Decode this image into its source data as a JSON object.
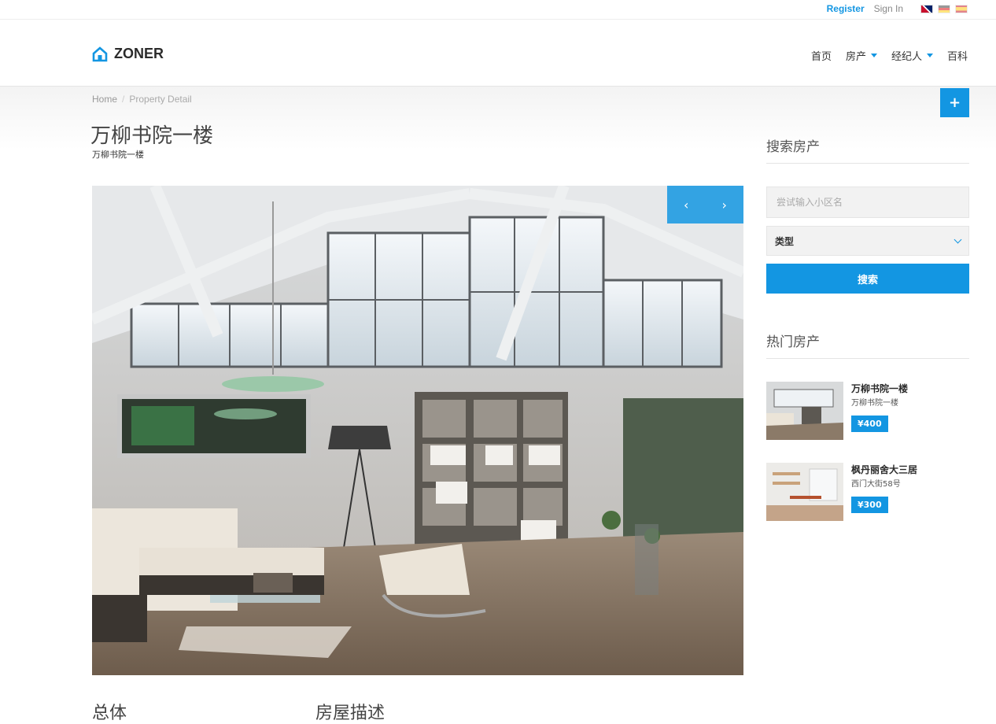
{
  "topbar": {
    "register": "Register",
    "signin": "Sign In"
  },
  "brand": {
    "name": "ZONER"
  },
  "nav": {
    "home": "首页",
    "property": "房产",
    "agents": "经纪人",
    "wiki": "百科"
  },
  "breadcrumb": {
    "home": "Home",
    "sep": "/",
    "current": "Property Detail"
  },
  "property": {
    "title": "万柳书院一楼",
    "subtitle": "万柳书院一楼"
  },
  "add_button": "+",
  "slider": {
    "prev": "‹",
    "next": "›"
  },
  "sections": {
    "overview": "总体",
    "description": "房屋描述"
  },
  "search": {
    "title": "搜索房产",
    "placeholder": "尝试输入小区名",
    "type_label": "类型",
    "button": "搜索"
  },
  "hot": {
    "title": "热门房产",
    "items": [
      {
        "name": "万柳书院一楼",
        "address": "万柳书院一楼",
        "price": "¥400"
      },
      {
        "name": "枫丹丽舍大三居",
        "address": "西门大街58号",
        "price": "¥300"
      }
    ]
  },
  "colors": {
    "accent": "#1396e2"
  }
}
